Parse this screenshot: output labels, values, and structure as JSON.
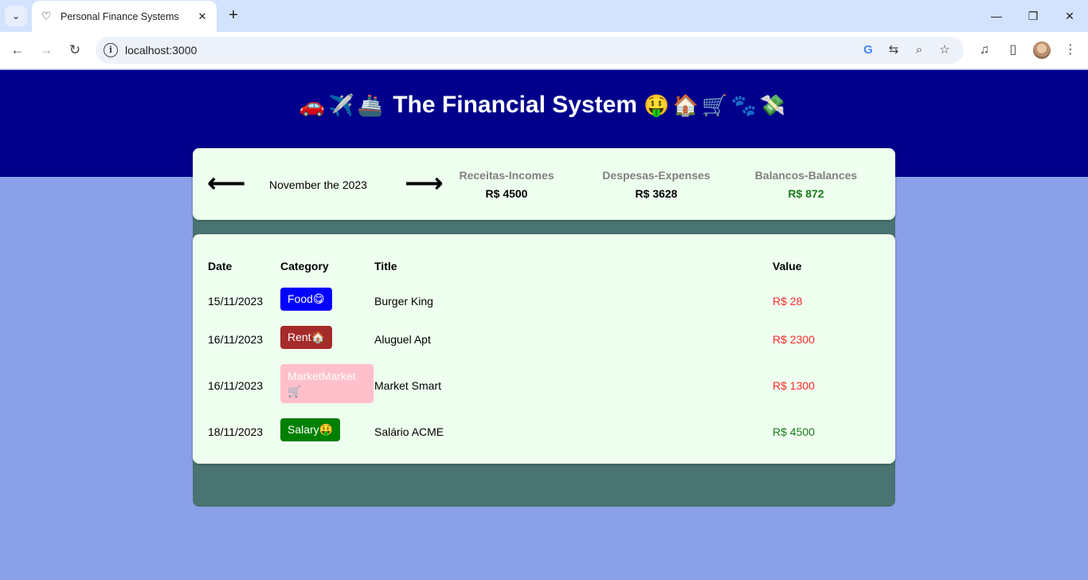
{
  "browser": {
    "tab_title": "Personal Finance Systems",
    "url": "localhost:3000"
  },
  "app": {
    "title": "The Financial System",
    "title_emoji_left": "🚗✈️🚢",
    "title_emoji_right": "🤑🏠🛒🐾💸"
  },
  "summary": {
    "month_label": "November the 2023",
    "prev_icon": "arrow-left-icon",
    "next_icon": "arrow-right-icon",
    "incomes_label": "Receitas-Incomes",
    "incomes_value": "R$ 4500",
    "expenses_label": "Despesas-Expenses",
    "expenses_value": "R$ 3628",
    "balance_label": "Balancos-Balances",
    "balance_value": "R$ 872",
    "balance_color": "#1a7a1a"
  },
  "table": {
    "headers": {
      "date": "Date",
      "category": "Category",
      "title": "Title",
      "value": "Value"
    },
    "rows": [
      {
        "date": "15/11/2023",
        "category": "Food😋",
        "category_color": "#0000ff",
        "title": "Burger King",
        "value": "R$ 28",
        "type": "expense"
      },
      {
        "date": "16/11/2023",
        "category": "Rent🏠",
        "category_color": "#a52a2a",
        "title": "Aluguel Apt",
        "value": "R$ 2300",
        "type": "expense"
      },
      {
        "date": "16/11/2023",
        "category": "MarketMarket 🛒",
        "category_color": "#ffc0cb",
        "title": "Market Smart",
        "value": "R$ 1300",
        "type": "expense"
      },
      {
        "date": "18/11/2023",
        "category": "Salary🤑",
        "category_color": "#008000",
        "title": "Salário ACME",
        "value": "R$ 4500",
        "type": "income"
      }
    ]
  },
  "colors": {
    "header_bg": "#00008b",
    "page_bg": "#8aa0e8",
    "card_bg": "#efffef",
    "board_bg": "#4a7472",
    "expense": "#ff2a2a",
    "income": "#1a7a1a"
  }
}
